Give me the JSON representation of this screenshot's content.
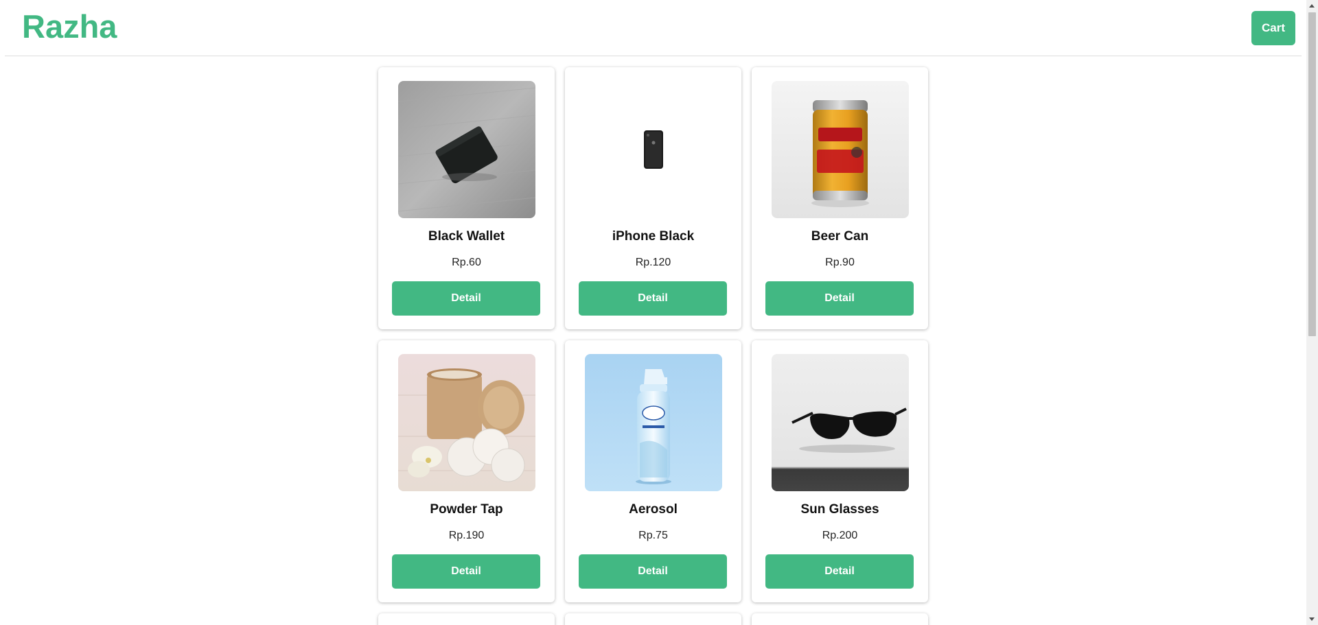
{
  "header": {
    "logo": "Razha",
    "cart_label": "Cart"
  },
  "products": [
    {
      "name": "Black Wallet",
      "price": "Rp.60",
      "button": "Detail",
      "image": "wallet-photo"
    },
    {
      "name": "iPhone Black",
      "price": "Rp.120",
      "button": "Detail",
      "image": "phone-photo"
    },
    {
      "name": "Beer Can",
      "price": "Rp.90",
      "button": "Detail",
      "image": "beer-can-photo"
    },
    {
      "name": "Powder Tap",
      "price": "Rp.190",
      "button": "Detail",
      "image": "powder-tap-photo"
    },
    {
      "name": "Aerosol",
      "price": "Rp.75",
      "button": "Detail",
      "image": "aerosol-photo"
    },
    {
      "name": "Sun Glasses",
      "price": "Rp.200",
      "button": "Detail",
      "image": "sunglasses-photo"
    }
  ],
  "colors": {
    "accent": "#42b883",
    "button_text": "#ffffff"
  }
}
